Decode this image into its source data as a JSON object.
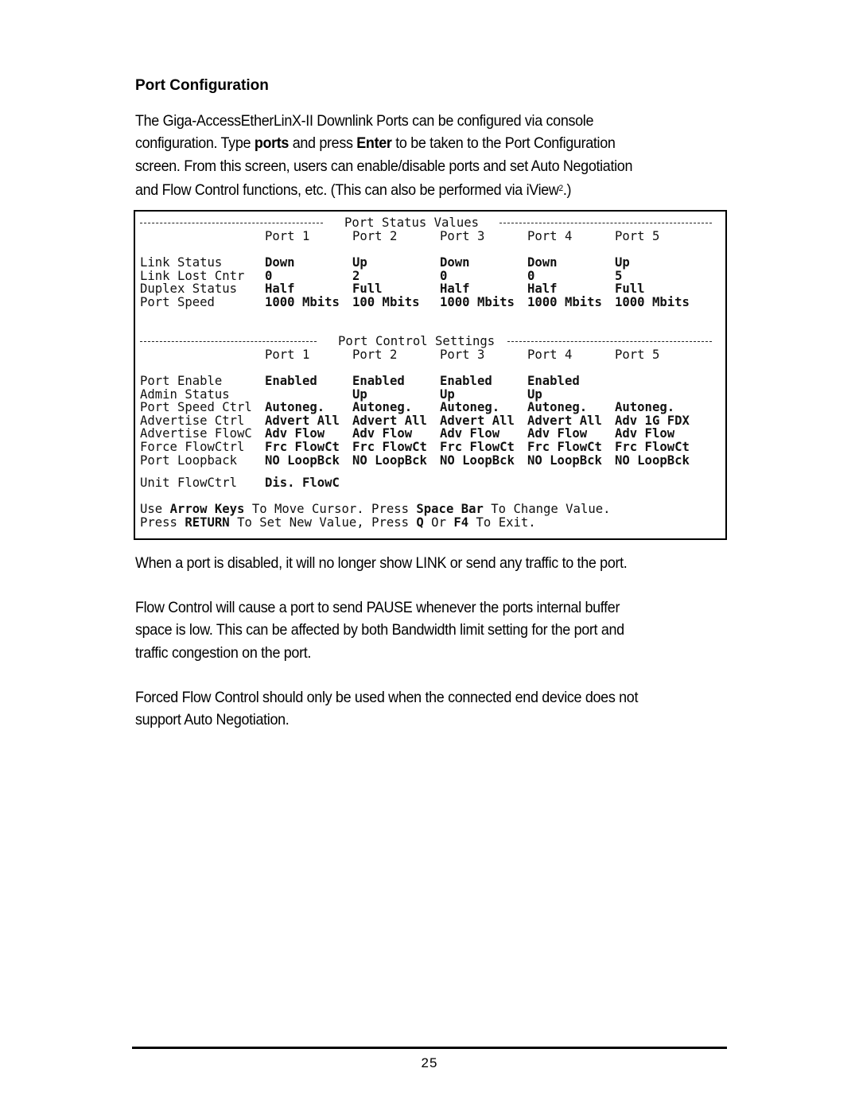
{
  "heading": "Port Configuration",
  "intro": {
    "line1": "The Giga-AccessEtherLinX-II Downlink Ports can be configured via console",
    "line2_a": "configuration.  Type ",
    "line2_b": "ports",
    "line2_c": " and press ",
    "line2_d": "Enter",
    "line2_e": " to be taken to the Port Configuration",
    "line3": "screen.  From this screen, users can enable/disable ports and set Auto Negotiation",
    "line4_a": "and Flow Control functions, etc. (This can also be performed via iView",
    "line4_sup": "2",
    "line4_b": ".)"
  },
  "terminal": {
    "status_section": {
      "title": "Port Status Values",
      "ports": [
        "Port 1",
        "Port 2",
        "Port 3",
        "Port 4",
        "Port 5"
      ],
      "rows": [
        {
          "label": "Link Status",
          "values": [
            "Down",
            "Up",
            "Down",
            "Down",
            "Up"
          ]
        },
        {
          "label": "Link Lost Cntr",
          "values": [
            "0",
            "2",
            "0",
            "0",
            "5"
          ]
        },
        {
          "label": "Duplex Status",
          "values": [
            "Half",
            "Full",
            "Half",
            "Half",
            "Full"
          ]
        },
        {
          "label": "Port Speed",
          "values": [
            "1000 Mbits",
            "100 Mbits",
            "1000 Mbits",
            "1000 Mbits",
            "1000 Mbits"
          ]
        }
      ]
    },
    "control_section": {
      "title": "Port Control Settings",
      "ports": [
        "Port 1",
        "Port 2",
        "Port 3",
        "Port 4",
        "Port 5"
      ],
      "rows": [
        {
          "label": "Port Enable",
          "values": [
            "Enabled",
            "Enabled",
            "Enabled",
            "Enabled",
            ""
          ]
        },
        {
          "label": "Admin Status",
          "values": [
            "",
            "Up",
            "Up",
            "Up",
            ""
          ]
        },
        {
          "label": "Port Speed Ctrl",
          "values": [
            "Autoneg.",
            "Autoneg.",
            "Autoneg.",
            "Autoneg.",
            "Autoneg."
          ]
        },
        {
          "label": "Advertise Ctrl",
          "values": [
            "Advert All",
            "Advert All",
            "Advert All",
            "Advert All",
            "Adv 1G FDX"
          ]
        },
        {
          "label": "Advertise FlowC",
          "values": [
            "Adv Flow",
            "Adv Flow",
            "Adv Flow",
            "Adv Flow",
            "Adv Flow"
          ]
        },
        {
          "label": "Force FlowCtrl",
          "values": [
            "Frc FlowCt",
            "Frc FlowCt",
            "Frc FlowCt",
            "Frc FlowCt",
            "Frc FlowCt"
          ]
        },
        {
          "label": "Port Loopback",
          "values": [
            "NO LoopBck",
            "NO LoopBck",
            "NO LoopBck",
            "NO LoopBck",
            "NO LoopBck"
          ]
        }
      ],
      "unit_flowctrl_label": "Unit FlowCtrl",
      "unit_flowctrl_value": "Dis. FlowC"
    },
    "help_line1": [
      {
        "text": "Use ",
        "bold": false
      },
      {
        "text": "Arrow Keys",
        "bold": true
      },
      {
        "text": " To Move Cursor. Press ",
        "bold": false
      },
      {
        "text": "Space Bar",
        "bold": true
      },
      {
        "text": " To Change Value.",
        "bold": false
      }
    ],
    "help_line2": [
      {
        "text": "Press ",
        "bold": false
      },
      {
        "text": "RETURN",
        "bold": true
      },
      {
        "text": " To Set New Value, Press ",
        "bold": false
      },
      {
        "text": "Q",
        "bold": true
      },
      {
        "text": " Or ",
        "bold": false
      },
      {
        "text": "F4",
        "bold": true
      },
      {
        "text": " To Exit.",
        "bold": false
      }
    ]
  },
  "paragraphs": {
    "disabled": "When a port is disabled, it will no longer show LINK or send any traffic to the port.",
    "flow_line1": "Flow Control will cause a port to send PAUSE whenever the ports internal buffer",
    "flow_line2": "space is low.  This can be affected by both Bandwidth limit setting for the port and",
    "flow_line3": "traffic congestion on the port.",
    "forced_line1": "Forced Flow Control should only be used when the connected end device does not",
    "forced_line2": "support Auto Negotiation."
  },
  "page_number": "25"
}
